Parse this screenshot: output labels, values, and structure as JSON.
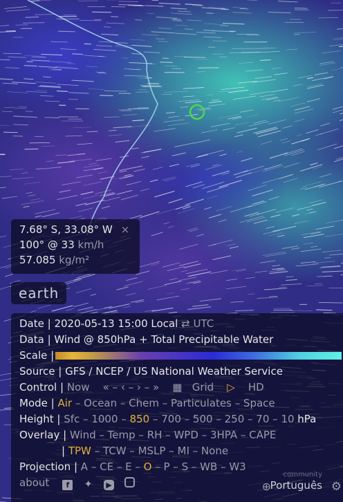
{
  "spot": {
    "coords": "7.68° S, 33.08° W",
    "close": "×",
    "wind_value": "100° @ 33",
    "wind_unit": "km/h",
    "tpw_value": "57.085",
    "tpw_unit": "kg/m²"
  },
  "brand": "earth",
  "menu": {
    "date": {
      "label": "Date |",
      "value": "2020-05-13 15:00 Local",
      "swap": "⇄",
      "alt": "UTC"
    },
    "data": {
      "label": "Data |",
      "value": "Wind @ 850hPa + Total Precipitable Water"
    },
    "scale": {
      "label": "Scale |"
    },
    "source": {
      "label": "Source |",
      "value": "GFS / NCEP / US National Weather Service"
    },
    "control": {
      "label": "Control |",
      "now": "Now",
      "nav": [
        "«",
        "–",
        "‹",
        "–",
        "›",
        "–",
        "»"
      ],
      "calendar": "▦",
      "grid": "Grid",
      "play": "▷",
      "hd": "HD"
    },
    "mode": {
      "label": "Mode |",
      "options": [
        "Air",
        "Ocean",
        "Chem",
        "Particulates",
        "Space"
      ],
      "selected": "Air"
    },
    "height": {
      "label": "Height |",
      "options": [
        "Sfc",
        "1000",
        "850",
        "700",
        "500",
        "250",
        "70",
        "10"
      ],
      "unit": "hPa",
      "selected": "850"
    },
    "overlay": {
      "label": "Overlay |",
      "options_row1": [
        "Wind",
        "Temp",
        "RH",
        "WPD",
        "3HPA",
        "CAPE"
      ],
      "options_row2": [
        "TPW",
        "TCW",
        "MSLP",
        "MI",
        "None"
      ],
      "row2_prefix": "|",
      "selected": "TPW"
    },
    "projection": {
      "label": "Projection |",
      "options": [
        "A",
        "CE",
        "E",
        "O",
        "P",
        "S",
        "WB",
        "W3"
      ],
      "selected": "O"
    },
    "footer": {
      "about": "about",
      "social_icons": [
        "facebook-icon",
        "twitter-icon",
        "youtube-icon",
        "instagram-icon"
      ],
      "community": "community",
      "language": "Português",
      "globe_icon": "⊕",
      "gear_icon": "⚙"
    }
  },
  "colors": {
    "accent": "#e0b23c",
    "marker": "#4cd84c",
    "coastline": "#a8d8f0",
    "panel_bg": "rgba(10,10,30,0.72)"
  }
}
